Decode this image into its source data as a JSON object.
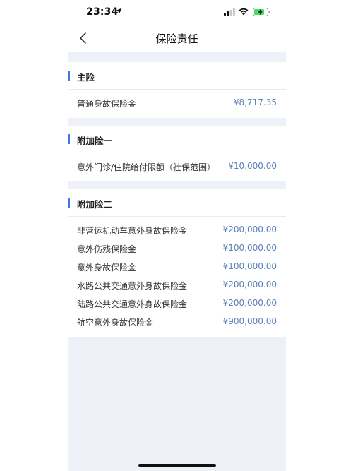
{
  "status_bar": {
    "time": "23:34"
  },
  "nav": {
    "title": "保险责任"
  },
  "sections": [
    {
      "title": "主险",
      "rows": [
        {
          "label": "普通身故保险金",
          "value": "¥8,717.35"
        }
      ]
    },
    {
      "title": "附加险一",
      "rows": [
        {
          "label": "意外门诊/住院给付限额（社保范围）",
          "value": "¥10,000.00"
        }
      ]
    },
    {
      "title": "附加险二",
      "rows": [
        {
          "label": "非营运机动车意外身故保险金",
          "value": "¥200,000.00"
        },
        {
          "label": "意外伤残保险金",
          "value": "¥100,000.00"
        },
        {
          "label": "意外身故保险金",
          "value": "¥100,000.00"
        },
        {
          "label": "水路公共交通意外身故保险金",
          "value": "¥200,000.00"
        },
        {
          "label": "陆路公共交通意外身故保险金",
          "value": "¥200,000.00"
        },
        {
          "label": "航空意外身故保险金",
          "value": "¥900,000.00"
        }
      ]
    }
  ],
  "colors": {
    "accent": "#3d7be0",
    "value_text": "#5b7fb8",
    "page_background": "#eef2f8"
  },
  "icons": {
    "back": "chevron-left-icon",
    "location": "location-arrow-icon",
    "signal": "cellular-signal-icon",
    "wifi": "wifi-icon",
    "battery": "battery-charging-icon"
  }
}
